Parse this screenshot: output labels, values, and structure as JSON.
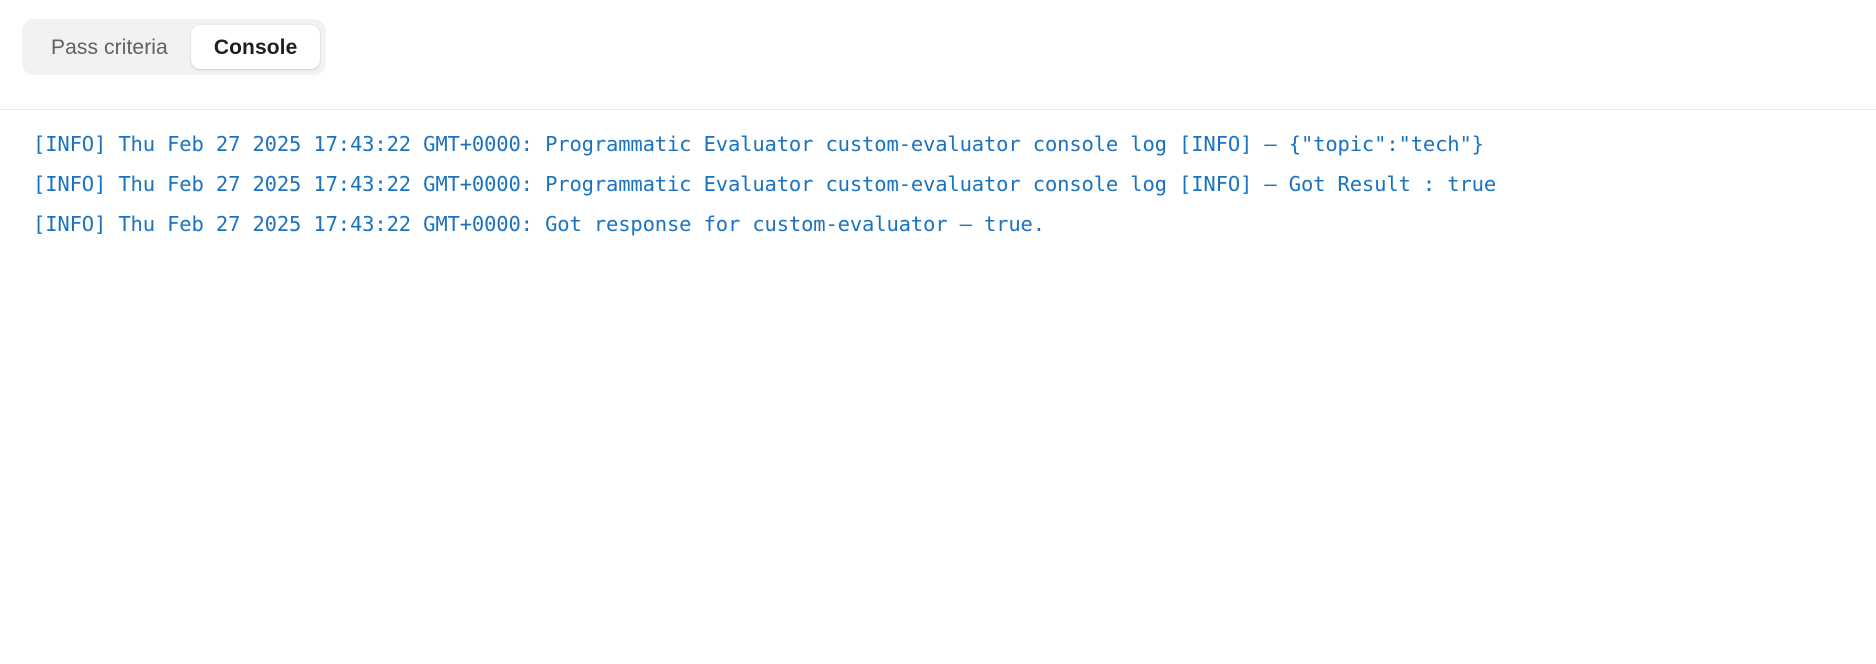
{
  "tabs": [
    {
      "label": "Pass criteria",
      "active": false
    },
    {
      "label": "Console",
      "active": true
    }
  ],
  "colors": {
    "log_text": "#1a73c0",
    "tab_group_bg": "#f2f2f3",
    "active_tab_bg": "#ffffff",
    "inactive_tab_text": "#5f6166",
    "active_tab_text": "#1d1f24",
    "divider": "#e9e9ea",
    "page_bg": "#ffffff"
  },
  "console": {
    "lines": [
      "[INFO] Thu Feb 27 2025 17:43:22 GMT+0000: Programmatic Evaluator custom-evaluator console log [INFO] – {\"topic\":\"tech\"}",
      "[INFO] Thu Feb 27 2025 17:43:22 GMT+0000: Programmatic Evaluator custom-evaluator console log [INFO] – Got Result : true",
      "[INFO] Thu Feb 27 2025 17:43:22 GMT+0000: Got response for custom-evaluator – true."
    ]
  }
}
